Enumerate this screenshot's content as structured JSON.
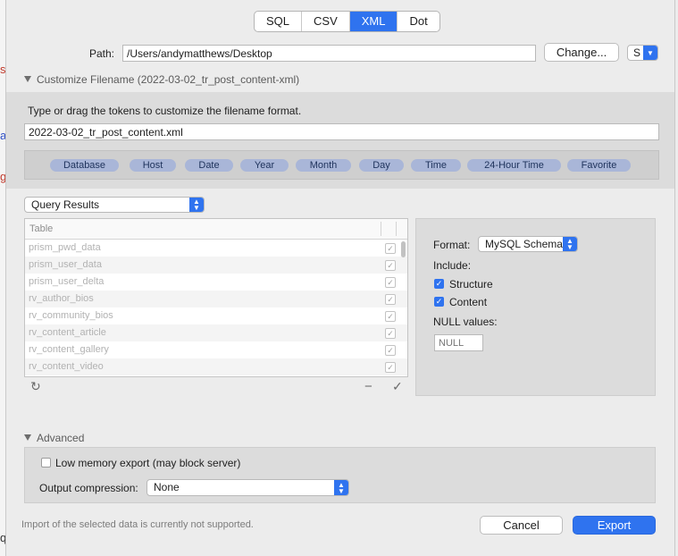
{
  "format_tabs": [
    {
      "label": "SQL",
      "active": false
    },
    {
      "label": "CSV",
      "active": false
    },
    {
      "label": "XML",
      "active": true
    },
    {
      "label": "Dot",
      "active": false
    }
  ],
  "path": {
    "label": "Path:",
    "value": "/Users/andymatthews/Desktop",
    "change_label": "Change...",
    "extra_popup": "S"
  },
  "customize": {
    "toggle_label": "Customize Filename (2022-03-02_tr_post_content-xml)",
    "instruction": "Type or drag the tokens to customize the filename format.",
    "filename": "2022-03-02_tr_post_content.xml",
    "tokens": [
      "Database",
      "Host",
      "Date",
      "Year",
      "Month",
      "Day",
      "Time",
      "24-Hour Time",
      "Favorite"
    ]
  },
  "source": {
    "selected": "Query Results"
  },
  "table": {
    "header": "Table",
    "rows": [
      {
        "name": "prism_pwd_data",
        "checked": true
      },
      {
        "name": "prism_user_data",
        "checked": true
      },
      {
        "name": "prism_user_delta",
        "checked": true
      },
      {
        "name": "rv_author_bios",
        "checked": true
      },
      {
        "name": "rv_community_bios",
        "checked": true
      },
      {
        "name": "rv_content_article",
        "checked": true
      },
      {
        "name": "rv_content_gallery",
        "checked": true
      },
      {
        "name": "rv_content_video",
        "checked": true
      }
    ]
  },
  "options": {
    "format_label": "Format:",
    "format_value": "MySQL Schema",
    "include_label": "Include:",
    "structure_label": "Structure",
    "content_label": "Content",
    "null_label": "NULL values:",
    "null_placeholder": "NULL"
  },
  "advanced": {
    "toggle_label": "Advanced",
    "low_memory_label": "Low memory export (may block server)",
    "compression_label": "Output compression:",
    "compression_value": "None"
  },
  "footer": {
    "status": "Import of the selected data is currently not supported.",
    "cancel_label": "Cancel",
    "export_label": "Export"
  },
  "icons": {
    "refresh": "↻",
    "remove": "−",
    "check": "✓"
  },
  "colors": {
    "accent": "#2f73ef",
    "token_fill": "#a9b6d8"
  }
}
